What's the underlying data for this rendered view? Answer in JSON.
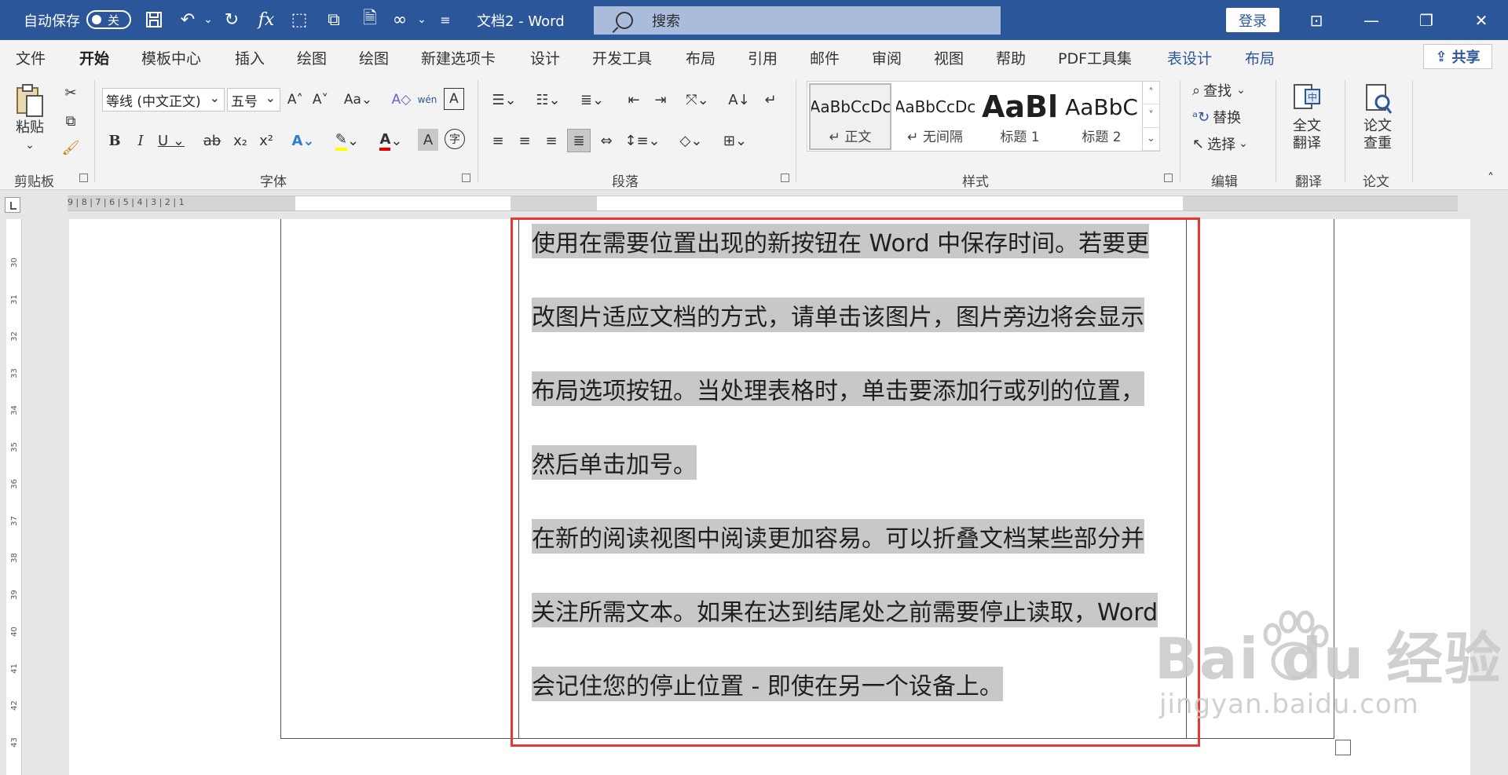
{
  "titlebar": {
    "autosave_label": "自动保存",
    "autosave_state": "关",
    "doc_title": "文档2  -  Word",
    "search_placeholder": "搜索",
    "login_label": "登录",
    "bg_color": "#2b579a"
  },
  "tabs": [
    {
      "label": "文件"
    },
    {
      "label": "开始"
    },
    {
      "label": "模板中心"
    },
    {
      "label": "插入"
    },
    {
      "label": "绘图"
    },
    {
      "label": "绘图"
    },
    {
      "label": "新建选项卡"
    },
    {
      "label": "设计"
    },
    {
      "label": "开发工具"
    },
    {
      "label": "布局"
    },
    {
      "label": "引用"
    },
    {
      "label": "邮件"
    },
    {
      "label": "审阅"
    },
    {
      "label": "视图"
    },
    {
      "label": "帮助"
    },
    {
      "label": "PDF工具集"
    },
    {
      "label": "表设计"
    },
    {
      "label": "布局"
    }
  ],
  "share_label": "共享",
  "ribbon": {
    "clipboard": {
      "paste_label": "粘贴",
      "group_label": "剪贴板"
    },
    "font": {
      "font_name": "等线 (中文正文)",
      "font_size": "五号",
      "group_label": "字体"
    },
    "paragraph": {
      "group_label": "段落"
    },
    "styles": {
      "group_label": "样式",
      "items": [
        {
          "sample": "AaBbCcDc",
          "name": "↵ 正文"
        },
        {
          "sample": "AaBbCcDc",
          "name": "↵ 无间隔"
        },
        {
          "sample": "AaBl",
          "name": "标题 1"
        },
        {
          "sample": "AaBbC",
          "name": "标题 2"
        }
      ]
    },
    "editing": {
      "find_label": "查找",
      "replace_label": "替换",
      "select_label": "选择",
      "group_label": "编辑"
    },
    "translate": {
      "button_label_1": "全文",
      "button_label_2": "翻译",
      "group_label": "翻译"
    },
    "paper": {
      "button_label_1": "论文",
      "button_label_2": "查重",
      "group_label": "论文"
    }
  },
  "ruler": {
    "numbers": "9 | 8 | 7 | 6 | 5 | 4 | 3 | 2 | 1"
  },
  "document": {
    "lines": [
      "使用在需要位置出现的新按钮在 Word 中保存时间。若要更",
      "改图片适应文档的方式，请单击该图片，图片旁边将会显示",
      "布局选项按钮。当处理表格时，单击要添加行或列的位置，",
      "然后单击加号。",
      "在新的阅读视图中阅读更加容易。可以折叠文档某些部分并",
      "关注所需文本。如果在达到结尾处之前需要停止读取，Word",
      "会记住您的停止位置 - 即使在另一个设备上。"
    ],
    "highlight_color": "#c8c8c8",
    "annotation_color": "#e53935"
  },
  "watermark": {
    "main": "Bai du 经验",
    "sub": "jingyan.baidu.com"
  }
}
